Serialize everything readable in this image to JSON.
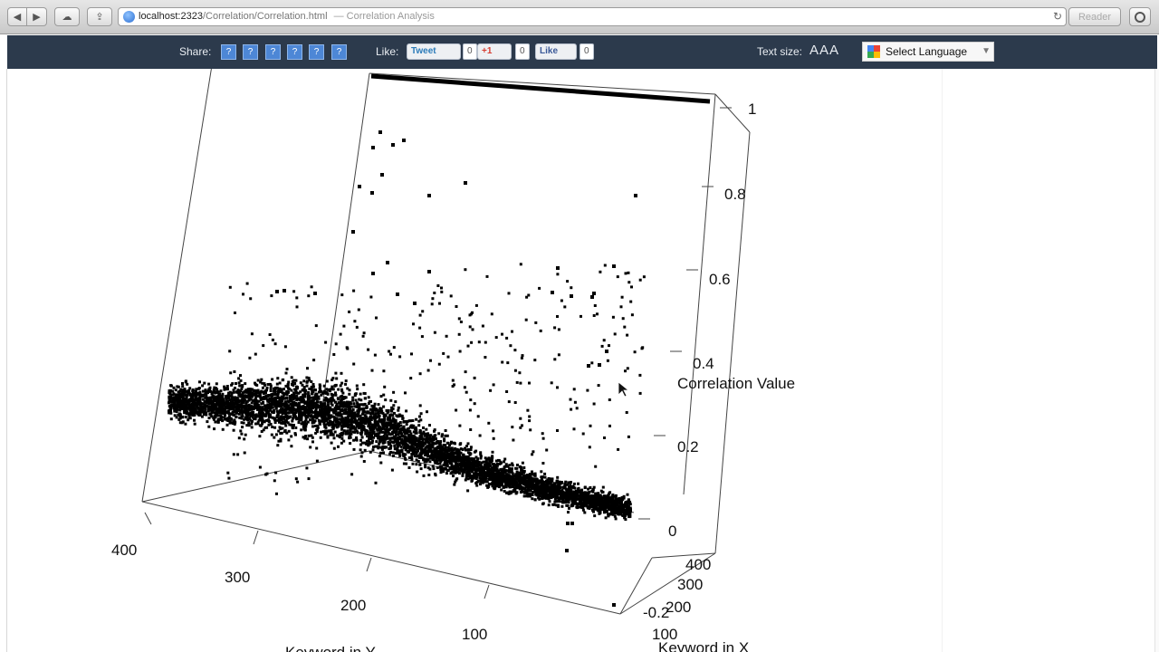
{
  "browser": {
    "url_host": "localhost:2323",
    "url_path": "/Correlation/Correlation.html",
    "page_title": "— Correlation Analysis",
    "reader_label": "Reader"
  },
  "sharebar": {
    "share_label": "Share:",
    "share_icon_glyph": "?",
    "like_label": "Like:",
    "tweet_label": "Tweet",
    "tweet_count": "0",
    "gplus_label": "+1",
    "gplus_count": "0",
    "fblike_label": "Like",
    "fblike_count": "0",
    "text_size_label": "Text size:",
    "text_size_options": "AAA",
    "language_select_label": "Select Language"
  },
  "chart_data": {
    "type": "scatter",
    "title": "",
    "xlabel": "Keyword in X",
    "ylabel": "Keyword in Y",
    "zlabel": "Correlation Value",
    "x_ticks": [
      "100",
      "200",
      "300",
      "400"
    ],
    "y_ticks": [
      "100",
      "200",
      "300",
      "400"
    ],
    "z_ticks": [
      "-0.2",
      "0",
      "0.2",
      "0.4",
      "0.6",
      "0.8",
      "1"
    ],
    "xlim": [
      0,
      450
    ],
    "ylim": [
      0,
      450
    ],
    "zlim": [
      -0.2,
      1
    ],
    "description": "3D scatter of pairwise keyword correlations; dense cloud of points roughly between 0 and 0.4, a line of points at 1 along the diagonal, sparse outliers up to about 0.9"
  }
}
